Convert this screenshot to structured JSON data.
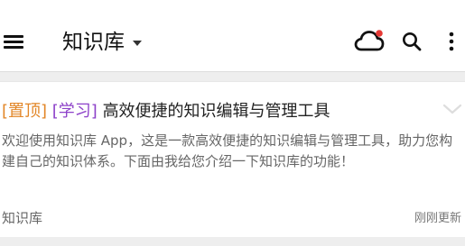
{
  "header": {
    "title": "知识库",
    "icons": {
      "menu": "menu-icon",
      "dropdown": "chevron-down-icon",
      "sync": "cloud-sync-icon",
      "search": "search-icon",
      "more": "more-vert-icon"
    },
    "colors": {
      "background": "#ffffff",
      "sync_indicator": "#e53935",
      "icon": "#111111"
    }
  },
  "note_card": {
    "tags": [
      {
        "label": "[置顶]",
        "color": "#e28627"
      },
      {
        "label": "[学习]",
        "color": "#8d41c9"
      }
    ],
    "title": "高效便捷的知识编辑与管理工具",
    "summary": "欢迎使用知识库 App，这是一款高效便捷的知识编辑与管理工具，助力您构建自己的知识体系。下面由我给您介绍一下知识库的功能！",
    "notebook": "知识库",
    "updated": "刚刚更新",
    "expand_icon": "chevron-down-icon"
  }
}
